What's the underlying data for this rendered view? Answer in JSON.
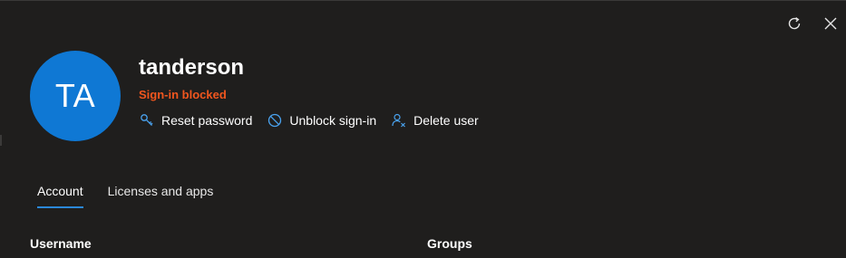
{
  "window_actions": {
    "refresh_icon": "refresh-icon",
    "close_icon": "close-icon"
  },
  "user": {
    "initials": "TA",
    "name": "tanderson",
    "status": "Sign-in blocked",
    "avatar_color": "#0f78d4",
    "status_color": "#f1561e"
  },
  "actions": [
    {
      "label": "Reset password",
      "icon": "key-icon"
    },
    {
      "label": "Unblock sign-in",
      "icon": "block-icon"
    },
    {
      "label": "Delete user",
      "icon": "delete-user-icon"
    }
  ],
  "tabs": [
    {
      "label": "Account",
      "active": true
    },
    {
      "label": "Licenses and apps",
      "active": false
    }
  ],
  "sections": {
    "username_label": "Username",
    "groups_label": "Groups"
  },
  "colors": {
    "accent": "#2b88d8",
    "background": "#1f1e1d"
  }
}
